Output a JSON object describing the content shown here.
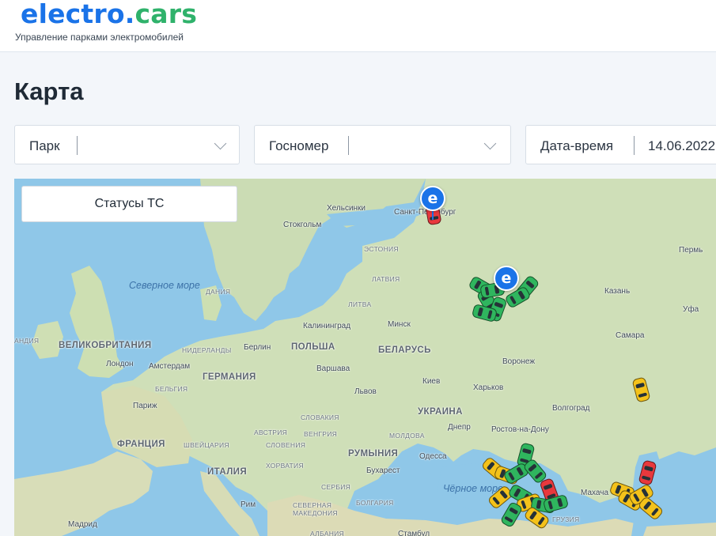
{
  "header": {
    "logo_part1": "electro",
    "logo_dot": ".",
    "logo_part2": "cars",
    "tagline": "Управление парками электромобилей"
  },
  "page": {
    "title": "Карта"
  },
  "filters": {
    "park_label": "Парк",
    "plate_label": "Госномер",
    "datetime_label": "Дата-время",
    "datetime_value": "14.06.2022"
  },
  "map": {
    "status_button": "Статусы ТС",
    "labels": {
      "helsinki": "Хельсинки",
      "spb": "Санкт-Петербург",
      "stockholm": "Стокгольм",
      "estonia": "ЭСТОНИЯ",
      "latvia": "ЛАТВИЯ",
      "lithuania": "ЛИТВА",
      "denmark": "ДАНИЯ",
      "north_sea": "Северное море",
      "kaliningrad": "Калининград",
      "minsk": "Минск",
      "uk": "ВЕЛИКОБРИТАНИЯ",
      "netherlands": "НИДЕРЛАНДЫ",
      "berlin": "Берлин",
      "poland": "ПОЛЬША",
      "belarus": "БЕЛАРУСЬ",
      "london": "Лондон",
      "amsterdam": "Амстердам",
      "warsaw": "Варшава",
      "germany": "ГЕРМАНИЯ",
      "belgium": "БЕЛЬГИЯ",
      "paris": "Париж",
      "lviv": "Львов",
      "kyiv": "Киев",
      "kharkiv": "Харьков",
      "voronezh": "Воронеж",
      "kazan": "Казань",
      "perm": "Пермь",
      "ufa": "Уфа",
      "samara": "Самара",
      "volgograd": "Волгоград",
      "ukraine": "УКРАИНА",
      "dnipro": "Днепр",
      "rostov": "Ростов-на-Дону",
      "slovakia": "СЛОВАКИЯ",
      "austria": "АВСТРИЯ",
      "hungary": "ВЕНГРИЯ",
      "moldova": "МОЛДОВА",
      "france": "ФРАНЦИЯ",
      "switzerland": "ШВЕЙЦАРИЯ",
      "slovenia": "СЛОВЕНИЯ",
      "romania": "РУМЫНИЯ",
      "odessa": "Одесса",
      "croatia": "ХОРВАТИЯ",
      "italy": "ИТАЛИЯ",
      "serbia": "СЕРБИЯ",
      "bucharest": "Бухарест",
      "black_sea": "Чёрное море",
      "rome": "Рим",
      "north_macedonia": "СЕВЕРНАЯ МАКЕДОНИЯ",
      "bulgaria": "БОЛГАРИЯ",
      "georgia": "ГРУЗИЯ",
      "albania": "АЛБАНИЯ",
      "istanbul": "Стамбул",
      "madrid": "Мадрид",
      "makhachkala": "Махача",
      "irl": "АНДИЯ"
    },
    "pin_glyph": "e",
    "colors": {
      "status_green": "#2fb55e",
      "status_yellow": "#f4c21a",
      "status_red": "#e8383d",
      "accent": "#1a73e8"
    }
  }
}
